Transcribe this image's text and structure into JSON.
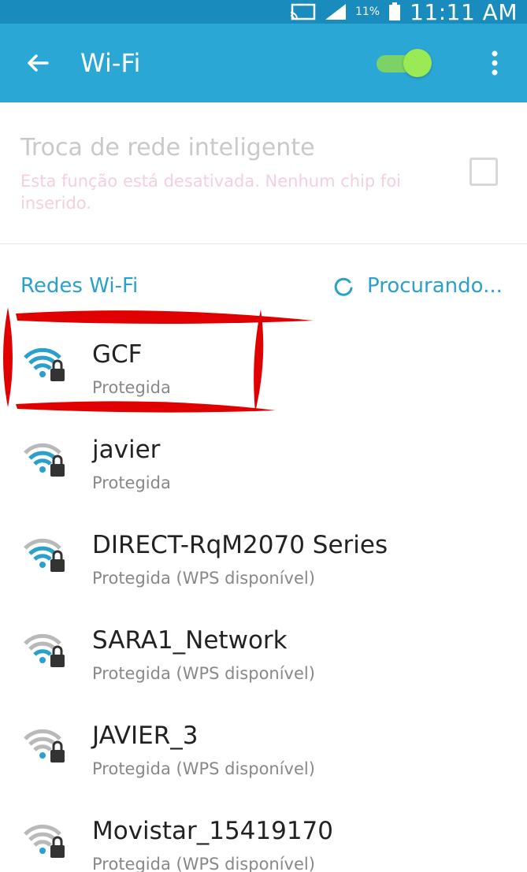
{
  "status_bar": {
    "battery_percent": "11%",
    "time": "11:11 AM"
  },
  "app_bar": {
    "title": "Wi-Fi",
    "wifi_enabled": true
  },
  "smart_switch": {
    "label": "Troca de rede inteligente",
    "description": "Esta função está desativada. Nenhum chip foi inserido.",
    "checked": false
  },
  "section": {
    "label": "Redes Wi-Fi",
    "scanning_text": "Procurando..."
  },
  "networks": [
    {
      "name": "GCF",
      "status": "Protegida"
    },
    {
      "name": "javier",
      "status": "Protegida"
    },
    {
      "name": "DIRECT-RqM2070 Series",
      "status": "Protegida (WPS disponível)"
    },
    {
      "name": "SARA1_Network",
      "status": "Protegida (WPS disponível)"
    },
    {
      "name": "JAVIER_3",
      "status": "Protegida (WPS disponível)"
    },
    {
      "name": "Movistar_15419170",
      "status": "Protegida (WPS disponível)"
    }
  ],
  "colors": {
    "status_bar": "#1a8bbd",
    "app_bar": "#2aa7d4",
    "accent": "#2aa0cc",
    "toggle_on": "#99ea55",
    "highlight": "#e00000"
  }
}
